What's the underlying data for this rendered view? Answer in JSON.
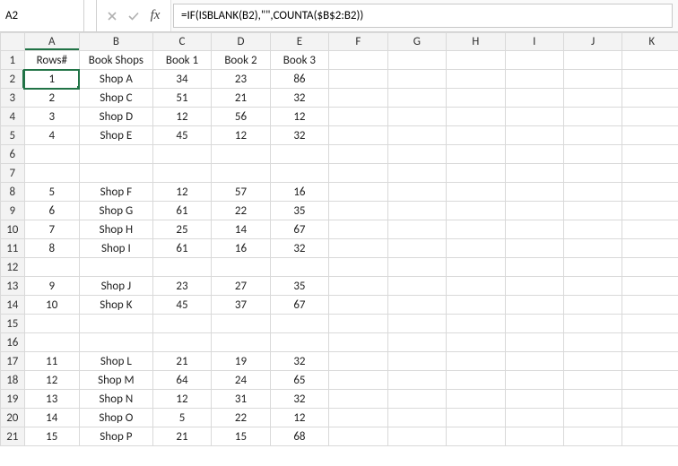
{
  "nameBox": {
    "value": "A2"
  },
  "formula": "=IF(ISBLANK(B2),\"\",COUNTA($B$2:B2))",
  "columns": [
    "A",
    "B",
    "C",
    "D",
    "E",
    "F",
    "G",
    "H",
    "I",
    "J",
    "K"
  ],
  "rows": [
    {
      "n": 1,
      "c": [
        "Rows#",
        "Book Shops",
        "Book 1",
        "Book 2",
        "Book 3",
        "",
        "",
        "",
        "",
        "",
        ""
      ]
    },
    {
      "n": 2,
      "c": [
        "1",
        "Shop A",
        "34",
        "23",
        "86",
        "",
        "",
        "",
        "",
        "",
        ""
      ]
    },
    {
      "n": 3,
      "c": [
        "2",
        "Shop C",
        "51",
        "21",
        "32",
        "",
        "",
        "",
        "",
        "",
        ""
      ]
    },
    {
      "n": 4,
      "c": [
        "3",
        "Shop D",
        "12",
        "56",
        "12",
        "",
        "",
        "",
        "",
        "",
        ""
      ]
    },
    {
      "n": 5,
      "c": [
        "4",
        "Shop E",
        "45",
        "12",
        "32",
        "",
        "",
        "",
        "",
        "",
        ""
      ]
    },
    {
      "n": 6,
      "c": [
        "",
        "",
        "",
        "",
        "",
        "",
        "",
        "",
        "",
        "",
        ""
      ]
    },
    {
      "n": 7,
      "c": [
        "",
        "",
        "",
        "",
        "",
        "",
        "",
        "",
        "",
        "",
        ""
      ]
    },
    {
      "n": 8,
      "c": [
        "5",
        "Shop F",
        "12",
        "57",
        "16",
        "",
        "",
        "",
        "",
        "",
        ""
      ]
    },
    {
      "n": 9,
      "c": [
        "6",
        "Shop G",
        "61",
        "22",
        "35",
        "",
        "",
        "",
        "",
        "",
        ""
      ]
    },
    {
      "n": 10,
      "c": [
        "7",
        "Shop H",
        "25",
        "14",
        "67",
        "",
        "",
        "",
        "",
        "",
        ""
      ]
    },
    {
      "n": 11,
      "c": [
        "8",
        "Shop I",
        "61",
        "16",
        "32",
        "",
        "",
        "",
        "",
        "",
        ""
      ]
    },
    {
      "n": 12,
      "c": [
        "",
        "",
        "",
        "",
        "",
        "",
        "",
        "",
        "",
        "",
        ""
      ]
    },
    {
      "n": 13,
      "c": [
        "9",
        "Shop J",
        "23",
        "27",
        "35",
        "",
        "",
        "",
        "",
        "",
        ""
      ]
    },
    {
      "n": 14,
      "c": [
        "10",
        "Shop K",
        "45",
        "37",
        "67",
        "",
        "",
        "",
        "",
        "",
        ""
      ]
    },
    {
      "n": 15,
      "c": [
        "",
        "",
        "",
        "",
        "",
        "",
        "",
        "",
        "",
        "",
        ""
      ]
    },
    {
      "n": 16,
      "c": [
        "",
        "",
        "",
        "",
        "",
        "",
        "",
        "",
        "",
        "",
        ""
      ]
    },
    {
      "n": 17,
      "c": [
        "11",
        "Shop L",
        "21",
        "19",
        "32",
        "",
        "",
        "",
        "",
        "",
        ""
      ]
    },
    {
      "n": 18,
      "c": [
        "12",
        "Shop M",
        "64",
        "24",
        "65",
        "",
        "",
        "",
        "",
        "",
        ""
      ]
    },
    {
      "n": 19,
      "c": [
        "13",
        "Shop N",
        "12",
        "31",
        "32",
        "",
        "",
        "",
        "",
        "",
        ""
      ]
    },
    {
      "n": 20,
      "c": [
        "14",
        "Shop O",
        "5",
        "22",
        "12",
        "",
        "",
        "",
        "",
        "",
        ""
      ]
    },
    {
      "n": 21,
      "c": [
        "15",
        "Shop P",
        "21",
        "15",
        "68",
        "",
        "",
        "",
        "",
        "",
        ""
      ]
    }
  ],
  "selection": {
    "row": 2,
    "col": 0
  }
}
